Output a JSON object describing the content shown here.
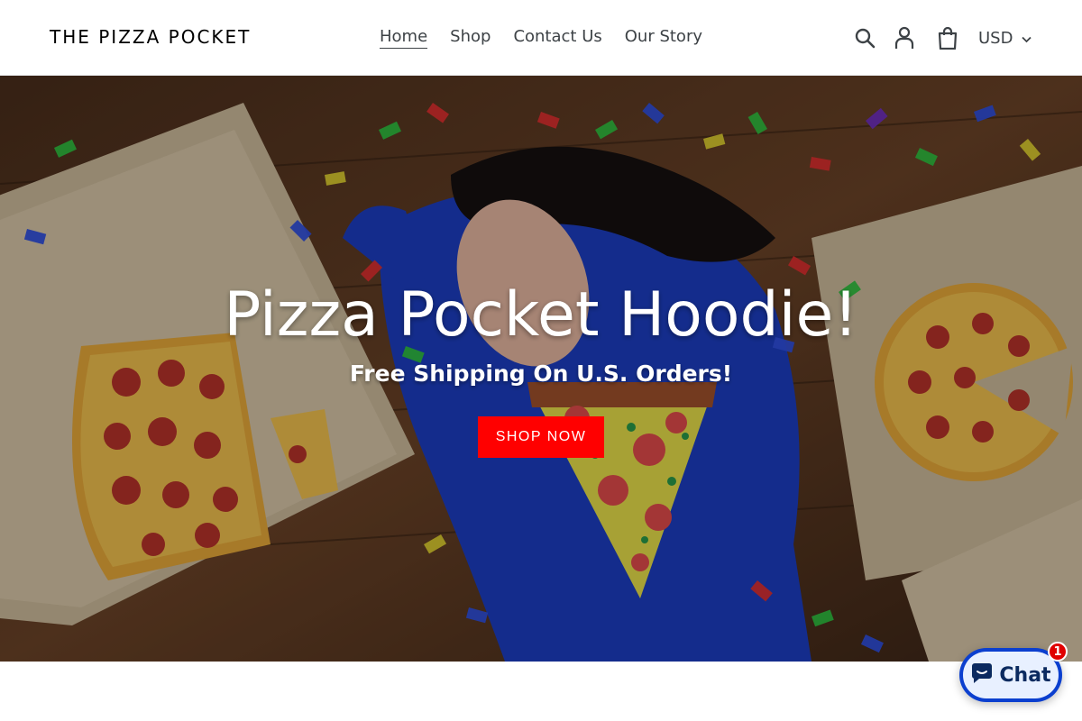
{
  "header": {
    "logo": "THE PIZZA POCKET",
    "nav": [
      {
        "label": "Home",
        "active": true
      },
      {
        "label": "Shop",
        "active": false
      },
      {
        "label": "Contact Us",
        "active": false
      },
      {
        "label": "Our Story",
        "active": false
      }
    ],
    "icons": {
      "search": "search-icon",
      "account": "user-icon",
      "cart": "cart-icon"
    },
    "currency": "USD"
  },
  "hero": {
    "title": "Pizza Pocket Hoodie!",
    "subtitle": "Free Shipping On U.S. Orders!",
    "button": "SHOP NOW",
    "button_color": "#ff0000"
  },
  "chat": {
    "label": "Chat",
    "badge": "1",
    "accent": "#0b3fcf"
  }
}
